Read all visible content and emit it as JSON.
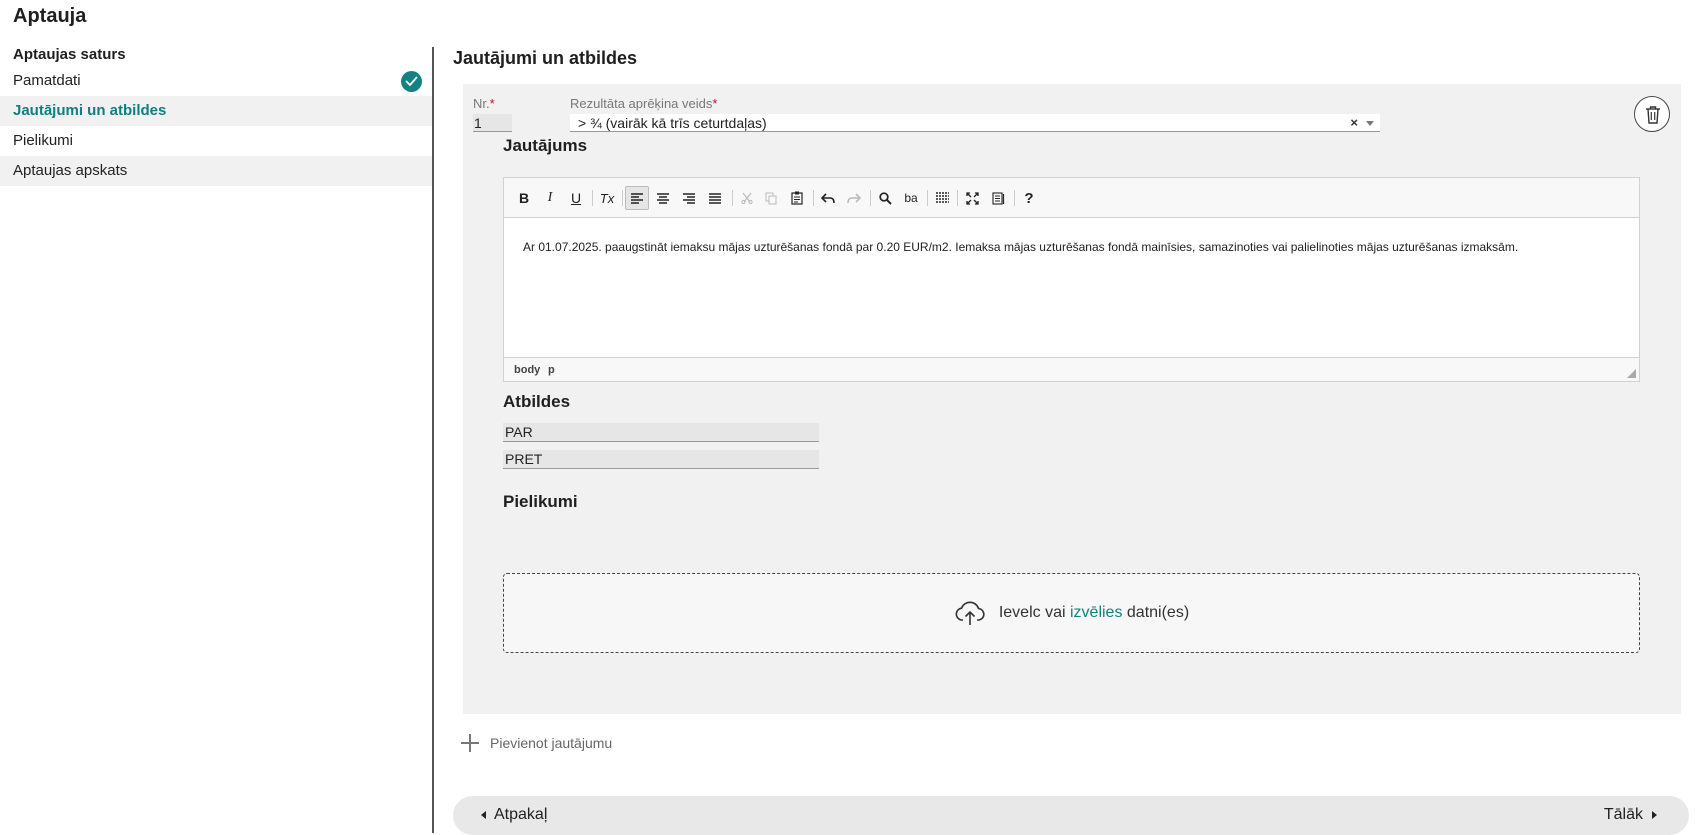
{
  "app": {
    "title": "Aptauja"
  },
  "sidebar": {
    "heading": "Aptaujas saturs",
    "items": [
      {
        "label": "Pamatdati",
        "completed": true
      },
      {
        "label": "Jautājumi un atbildes",
        "active": true
      },
      {
        "label": "Pielikumi"
      },
      {
        "label": "Aptaujas apskats"
      }
    ]
  },
  "section": {
    "title": "Jautājumi un atbildes"
  },
  "question": {
    "nr_label": "Nr.",
    "nr_value": "1",
    "required_mark": "*",
    "calc_label": "Rezultāta aprēķina veids",
    "calc_value": "> ¾ (vairāk kā trīs ceturtdaļas)",
    "clear_icon": "×",
    "question_title": "Jautājums",
    "editor_text": "Ar 01.07.2025. paaugstināt iemaksu mājas uzturēšanas fondā par 0.20 EUR/m2. Iemaksa mājas uzturēšanas fondā mainīsies, samazinoties vai palielinoties mājas uzturēšanas izmaksām.",
    "path_body": "body",
    "path_p": "p",
    "toolbar": {
      "bold": "B",
      "italic": "I",
      "underline": "U",
      "remove_format": "Tx",
      "find": "Q",
      "replace": "ba",
      "help": "?"
    },
    "answers_title": "Atbildes",
    "answers": [
      "PAR",
      "PRET"
    ],
    "attachments_title": "Pielikumi",
    "dropzone": {
      "prefix": "Ievelc vai",
      "link": "izvēlies",
      "suffix": "datni(es)"
    }
  },
  "add_question": {
    "label": "Pievienot jautājumu"
  },
  "navigation": {
    "back": "Atpakaļ",
    "next": "Tālāk"
  },
  "colors": {
    "accent": "#138283",
    "required": "#c8102e",
    "card_bg": "#f1f1f1"
  }
}
